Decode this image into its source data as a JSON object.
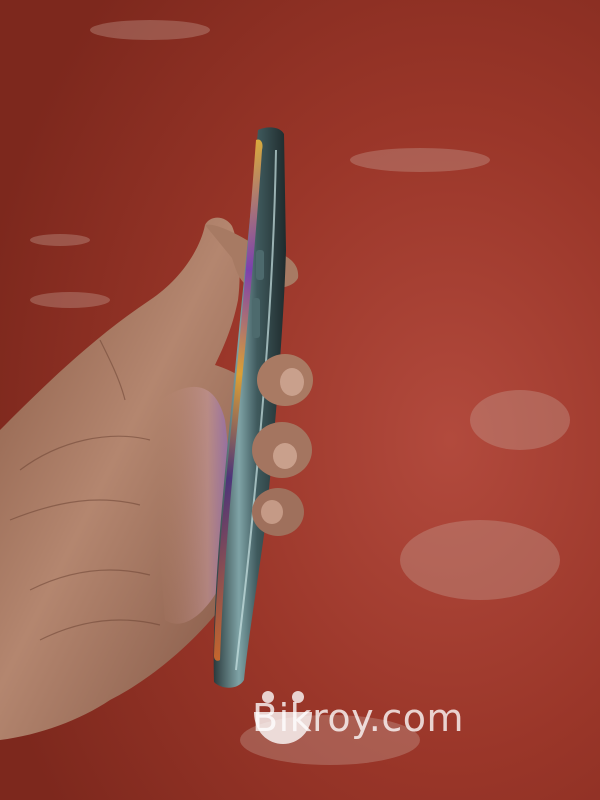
{
  "watermark": {
    "text": "Bikroy.com",
    "logo_icon": "bikroy-smiley-logo-icon",
    "color": "#ffffff"
  },
  "scene": {
    "floor_color": "#8e2f22",
    "skin_color": "#b2836c",
    "phone_frame_color": "#5d7d80"
  }
}
